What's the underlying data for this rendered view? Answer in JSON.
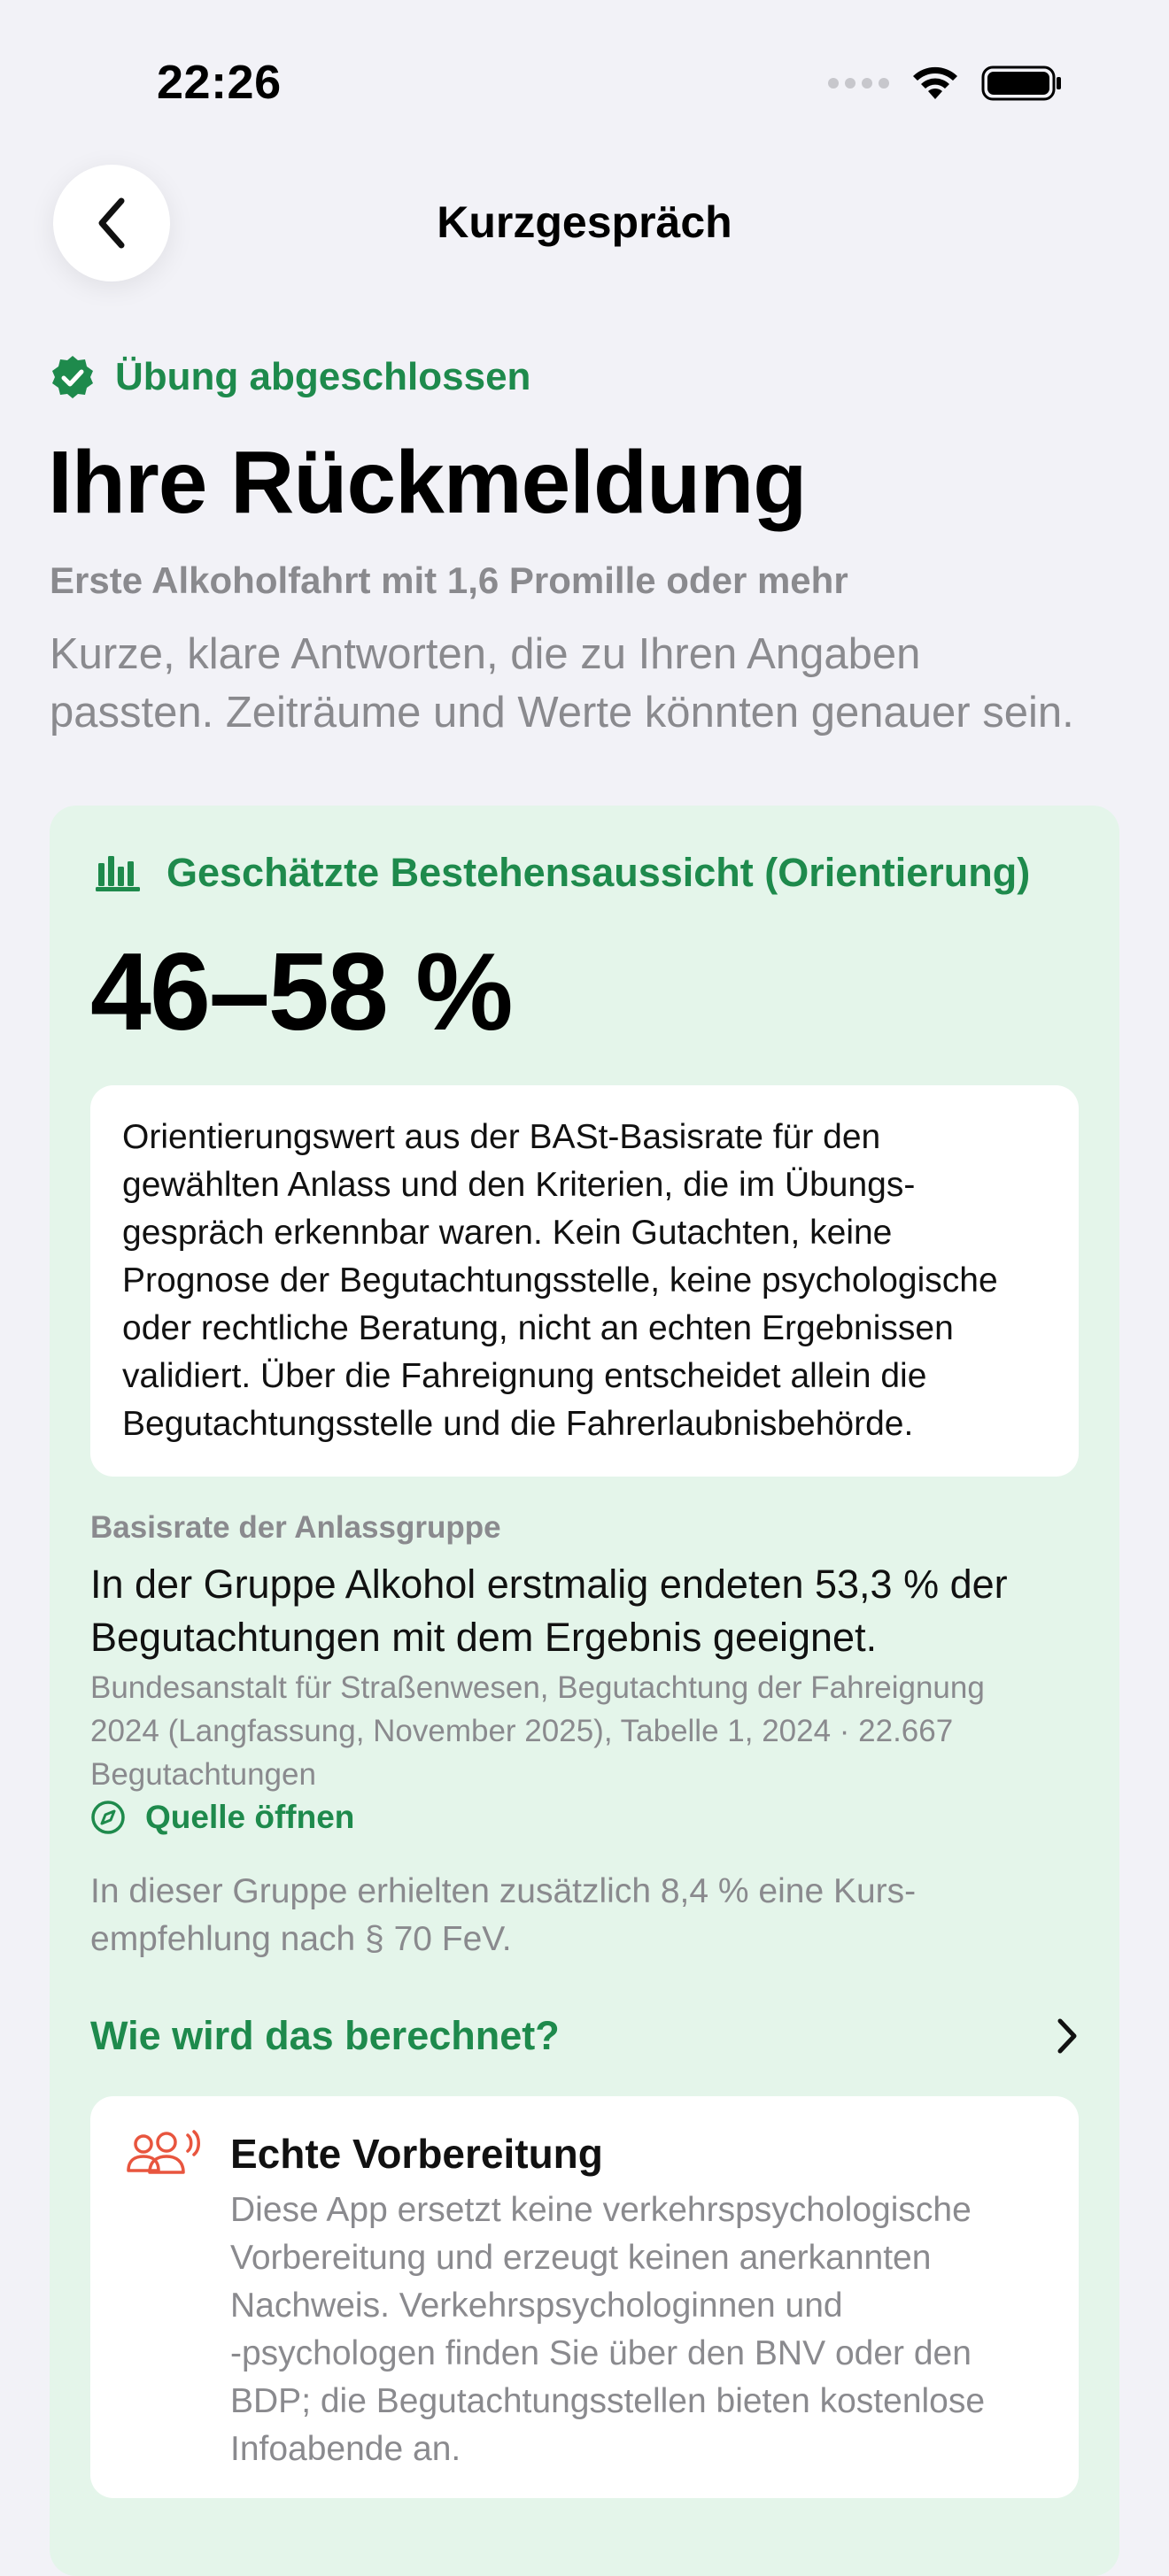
{
  "status_bar": {
    "time": "22:26"
  },
  "nav": {
    "title": "Kurzgespräch",
    "back_icon": "chevron-left-icon"
  },
  "header": {
    "badge": "Übung abgeschlossen",
    "title": "Ihre Rückmeldung",
    "subtitle": "Erste Alkoholfahrt mit 1,6 Promille oder mehr",
    "intro_line1": "Kurze, klare Antworten, die zu Ihren Angaben",
    "intro_line2": "passten. Zeiträume und Werte könnten genauer sein."
  },
  "estimate_card": {
    "heading": "Geschätzte Bestehensaussicht (Orientierung)",
    "range": "46–58 %",
    "note_lines": [
      "Orientierungswert aus der BASt-Basisrate für den",
      "gewählten Anlass und den Kriterien, die im Übungs-",
      "gespräch erkennbar waren. Kein Gutachten, keine",
      "Prognose der Begutachtungsstelle, keine psychologische",
      "oder rechtliche Beratung, nicht an echten Ergebnissen",
      "validiert. Über die Fahreignung entscheidet allein die",
      "Begutachtungsstelle und die Fahrerlaubnisbehörde."
    ],
    "base_rate_label": "Basisrate der Anlassgruppe",
    "base_rate_lines": [
      "In der Gruppe Alkohol erstmalig endeten 53,3 % der",
      "Begutachtungen mit dem Ergebnis geeignet."
    ],
    "source_lines": [
      "Bundesanstalt für Straßenwesen, Begutachtung der Fahreignung",
      "2024 (Langfassung, November 2025), Tabelle 1, 2024 · 22.667",
      "Begutachtungen"
    ],
    "source_link": "Quelle öffnen",
    "extra_lines": [
      "In dieser Gruppe erhielten zusätzlich 8,4 % eine Kurs-",
      "empfehlung nach § 70 FeV."
    ],
    "calc_link": "Wie wird das berechnet?",
    "prep": {
      "title": "Echte Vorbereitung",
      "lines": [
        "Diese App ersetzt keine verkehrspsychologische",
        "Vorbereitung und erzeugt keinen anerkannten",
        "Nachweis. Verkehrspsychologinnen und",
        "-psychologen finden Sie über den BNV oder den",
        "BDP; die Begutachtungsstellen bieten kostenlose",
        "Infoabende an."
      ]
    }
  },
  "colors": {
    "accent_green": "#1e8a4c",
    "card_bg": "#e4f5ea",
    "prep_icon": "#e8553e"
  }
}
